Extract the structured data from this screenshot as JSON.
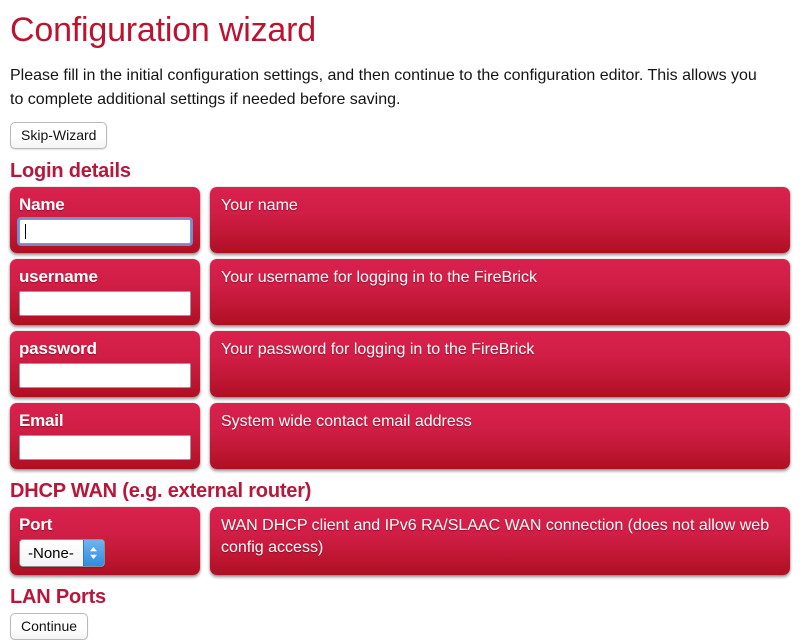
{
  "header": {
    "title": "Configuration wizard",
    "title_color": "#bb1430",
    "intro": "Please fill in the initial configuration settings, and then continue to the configuration editor. This allows you to complete additional settings if needed before saving."
  },
  "buttons": {
    "skip_wizard": "Skip-Wizard",
    "continue": "Continue"
  },
  "sections": [
    {
      "heading": "Login details",
      "fields": [
        {
          "label": "Name",
          "value": "",
          "placeholder": "",
          "description": "Your name",
          "focused": true,
          "type": "text"
        },
        {
          "label": "username",
          "value": "",
          "placeholder": "",
          "description": "Your username for logging in to the FireBrick",
          "focused": false,
          "type": "text"
        },
        {
          "label": "password",
          "value": "",
          "placeholder": "",
          "description": "Your password for logging in to the FireBrick",
          "focused": false,
          "type": "text"
        },
        {
          "label": "Email",
          "value": "",
          "placeholder": "",
          "description": "System wide contact email address",
          "focused": false,
          "type": "text"
        }
      ]
    },
    {
      "heading": "DHCP WAN (e.g. external router)",
      "fields": [
        {
          "label": "Port",
          "selected_option": "-None-",
          "options": [
            "-None-"
          ],
          "description": "WAN DHCP client and IPv6 RA/SLAAC WAN connection (does not allow web config access)",
          "type": "select"
        }
      ]
    },
    {
      "heading": "LAN Ports",
      "fields": []
    }
  ],
  "theme": {
    "heading_color": "#b8163a",
    "panel_gradient_top": "#d9214d",
    "panel_gradient_bottom": "#ae0f24",
    "focus_ring": "#6eaaf0",
    "stepper_blue": "#2f8ce0"
  }
}
